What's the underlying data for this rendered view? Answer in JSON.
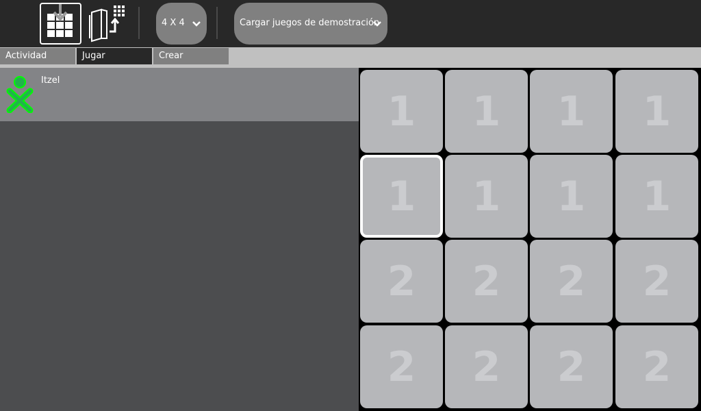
{
  "toolbar": {
    "size_combo": {
      "value": "4 X 4"
    },
    "demo_combo": {
      "value": "Cargar juegos de demostración"
    }
  },
  "tabs": [
    {
      "label": "Actividad"
    },
    {
      "label": "Jugar"
    },
    {
      "label": "Crear"
    }
  ],
  "players": [
    {
      "name": "Itzel",
      "icon": "xo-buddy-icon",
      "color": "#22b24c"
    }
  ],
  "board": {
    "cells": [
      "1",
      "1",
      "1",
      "1",
      "1",
      "1",
      "1",
      "1",
      "2",
      "2",
      "2",
      "2",
      "2",
      "2",
      "2",
      "2"
    ],
    "selected_index": 4
  }
}
